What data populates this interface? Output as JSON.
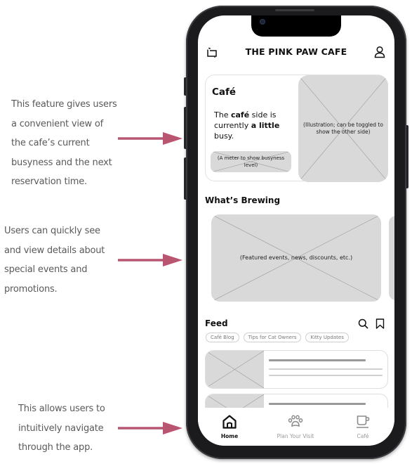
{
  "annotations": [
    {
      "id": "cafe-busyness",
      "lines": [
        "This feature gives users",
        "a convenient view of",
        "the cafe’s current",
        "busyness and the next",
        "reservation time."
      ]
    },
    {
      "id": "whats-brewing",
      "lines": [
        "Users can quickly see",
        "and view details about",
        "special events and",
        "promotions."
      ]
    },
    {
      "id": "navigation",
      "lines": [
        "This allows users to",
        "intuitively navigate",
        "through the app."
      ]
    }
  ],
  "colors": {
    "arrow": "#b85672",
    "placeholder": "#d9d9d9",
    "annotation_text": "#5a5a5a"
  },
  "app": {
    "header": {
      "title": "THE PINK PAW CAFE",
      "left_icon": "switch-side-icon",
      "right_icon": "user-profile-icon"
    },
    "cafe_card": {
      "title": "Café",
      "status_prefix": "The ",
      "status_bold1": "café",
      "status_mid": " side is currently ",
      "status_bold2": "a little",
      "status_suffix": " busy.",
      "meter_placeholder": "(A meter to show busyness level)",
      "illustration_placeholder": "(Illustration; can be toggled to show the other side)"
    },
    "whats_brewing": {
      "title": "What’s Brewing",
      "featured_placeholder": "(Featured events, news, discounts, etc.)"
    },
    "feed": {
      "title": "Feed",
      "search_icon": "search-icon",
      "bookmark_icon": "bookmark-icon",
      "chips": [
        "Café Blog",
        "Tips for Cat Owners",
        "Kitty Updates"
      ]
    },
    "bottom_nav": {
      "items": [
        {
          "label": "Home",
          "icon": "home-icon",
          "active": true
        },
        {
          "label": "Plan Your Visit",
          "icon": "paw-icon",
          "active": false
        },
        {
          "label": "Café",
          "icon": "coffee-cup-icon",
          "active": false
        }
      ]
    }
  }
}
